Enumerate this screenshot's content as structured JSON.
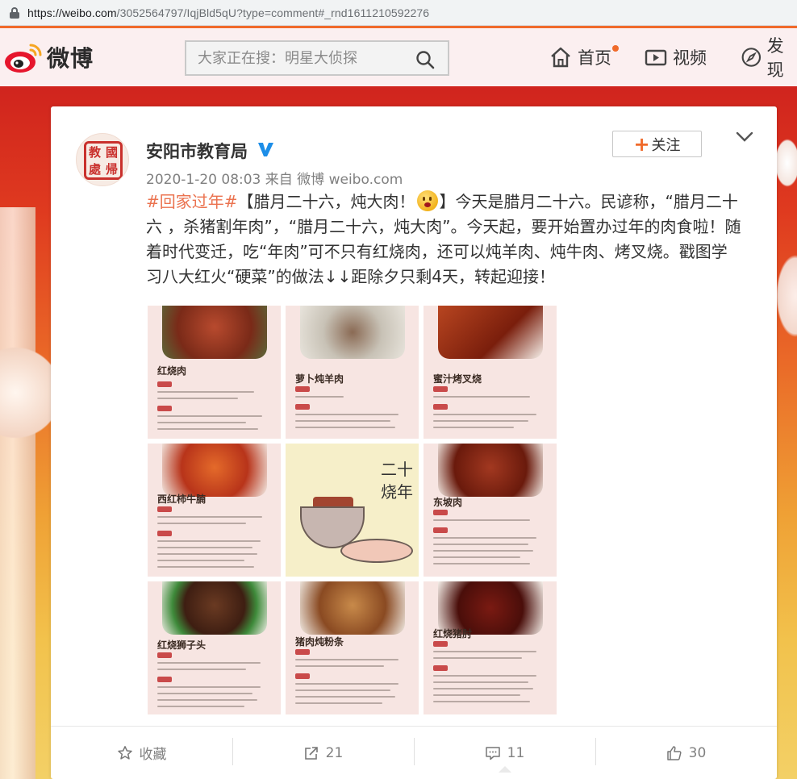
{
  "browser": {
    "url_host": "https://weibo.com",
    "url_path": "/3052564797/IqjBld5qU?type=comment#_rnd1611210592276"
  },
  "header": {
    "logo_text": "微博",
    "search_placeholder": "大家正在搜：明星大侦探",
    "nav": [
      {
        "label": "首页",
        "icon": "home-icon",
        "has_dot": true
      },
      {
        "label": "视频",
        "icon": "video-icon"
      },
      {
        "label": "发现",
        "icon": "compass-icon"
      }
    ]
  },
  "post": {
    "author": "安阳市教育局",
    "verified_icon": "verified-v-icon",
    "seal_chars": [
      "教",
      "國",
      "處",
      "帰"
    ],
    "meta": "2020-1-20 08:03 来自 微博 weibo.com",
    "follow_label": "关注",
    "topic": "#回家过年#",
    "text_after_topic": "【腊月二十六，炖大肉！",
    "text_rest": "】今天是腊月二十六。民谚称，“腊月二十六 ，杀猪割年肉”，“腊月二十六，炖大肉”。今天起，要开始置办过年的肉食啦！随着时代变迁，吃“年肉”可不只有红烧肉，还可以炖羊肉、炖牛肉、烤叉烧。戳图学习八大红火“硬菜”的做法↓↓距除夕只剩4天，转起迎接！",
    "images": [
      {
        "title": "红烧肉",
        "photo_color": "#8a2e1e"
      },
      {
        "title": "萝卜炖羊肉",
        "photo_color": "#b8b3a8"
      },
      {
        "title": "蜜汁烤叉烧",
        "photo_color": "#8e2a14"
      },
      {
        "title": "西红柿牛腩",
        "photo_color": "#c94a22"
      },
      {
        "title": "",
        "art_text": "二十六 烧年肉"
      },
      {
        "title": "东坡肉",
        "photo_color": "#7a2414"
      },
      {
        "title": "红烧狮子头",
        "photo_color": "#5a2a1e"
      },
      {
        "title": "猪肉炖粉条",
        "photo_color": "#9a6a3e"
      },
      {
        "title": "红烧猪肘",
        "photo_color": "#5c1410"
      }
    ],
    "art_line1": "二十",
    "art_line2": "烧年"
  },
  "actions": [
    {
      "label": "收藏",
      "icon": "star-icon"
    },
    {
      "label": "21",
      "icon": "share-icon"
    },
    {
      "label": "11",
      "icon": "comment-icon"
    },
    {
      "label": "30",
      "icon": "like-icon"
    }
  ],
  "colors": {
    "accent": "#f06a2a",
    "topic": "#eb7350",
    "verified": "#1d8ee8"
  }
}
